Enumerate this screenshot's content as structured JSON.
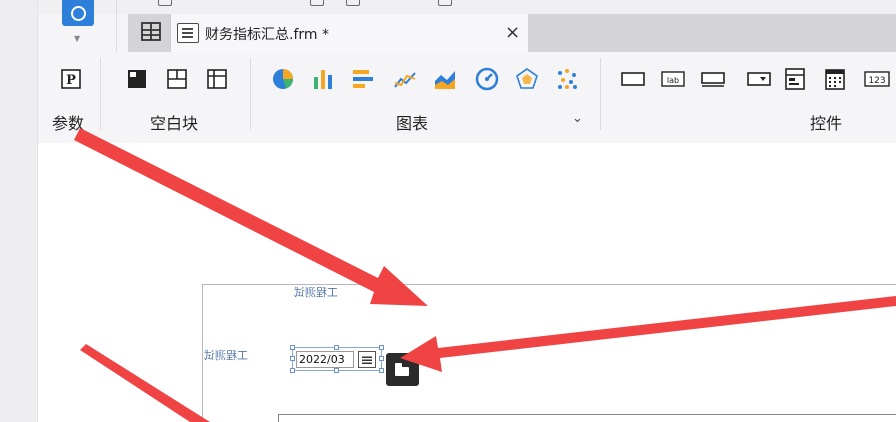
{
  "tab": {
    "title": "财务指标汇总.frm *",
    "close_glyph": "×"
  },
  "ribbon": {
    "groups": {
      "param_label": "参数",
      "block_label": "空白块",
      "chart_label": "图表",
      "control_label": "控件"
    },
    "control_text_icons": {
      "lab": "lab",
      "num": "123"
    },
    "param_icon_text": "P"
  },
  "canvas": {
    "label_top": "工程测试",
    "label_left": "工程测试",
    "date_value": "2022/03"
  },
  "colors": {
    "arrow": "#f04444",
    "accent_blue": "#2d7fd9"
  }
}
